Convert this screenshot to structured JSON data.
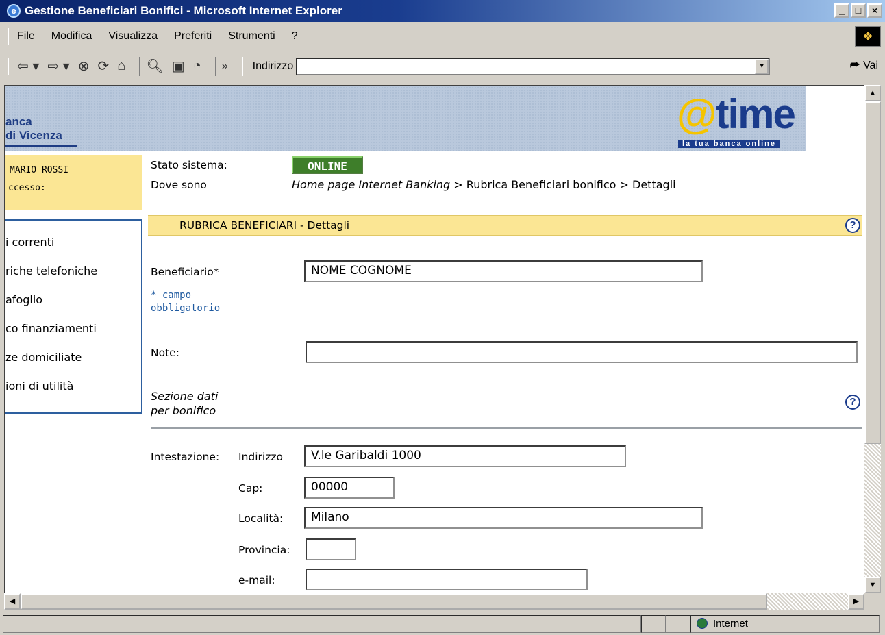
{
  "window": {
    "title": "Gestione Beneficiari Bonifici - Microsoft Internet Explorer",
    "buttons": [
      "_",
      "□",
      "×"
    ]
  },
  "menu": {
    "items": [
      "File",
      "Modifica",
      "Visualizza",
      "Preferiti",
      "Strumenti",
      "?"
    ]
  },
  "toolbar": {
    "chevron": "»",
    "address_label": "Indirizzo",
    "address_value": "",
    "go_label": "Vai"
  },
  "banner": {
    "bank_line1": "anca",
    "bank_line2": "di Vicenza",
    "logo_at": "@",
    "logo_text": "time",
    "logo_tagline": "la tua banca online"
  },
  "user": {
    "name": "MARIO ROSSI",
    "access_label": "ccesso:"
  },
  "nav": {
    "items": [
      "i correnti",
      "riche telefoniche",
      "afoglio",
      "co finanziamenti",
      "ze domiciliate",
      "ioni di utilità"
    ]
  },
  "status": {
    "system_label": "Stato sistema:",
    "system_value": "ONLINE",
    "where_label": "Dove sono",
    "breadcrumb_home": "Home page Internet Banking",
    "breadcrumb_rest": " > Rubrica Beneficiari bonifico > Dettagli"
  },
  "section": {
    "title": "RUBRICA BENEFICIARI - Dettagli",
    "help": "?"
  },
  "form": {
    "beneficiario_label": "Beneficiario*",
    "beneficiario_value": "NOME COGNOME",
    "required_note_1": "* campo",
    "required_note_2": "obbligatorio",
    "note_label": "Note:",
    "note_value": "",
    "section_note_1": "Sezione dati",
    "section_note_2": "per bonifico",
    "intestazione_label": "Intestazione:",
    "indirizzo_label": "Indirizzo",
    "indirizzo_value": "V.le Garibaldi 1000",
    "cap_label": "Cap:",
    "cap_value": "00000",
    "localita_label": "Località:",
    "localita_value": "Milano",
    "provincia_label": "Provincia:",
    "provincia_value": "",
    "email_label": "e-mail:",
    "email_value": ""
  },
  "statusbar": {
    "zone": "Internet"
  }
}
